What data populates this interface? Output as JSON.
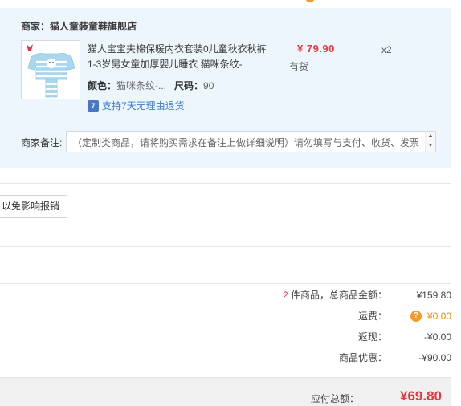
{
  "shop": {
    "label": "商家：",
    "name": "猫人童装童鞋旗舰店"
  },
  "product": {
    "title": "猫人宝宝夹棉保暖内衣套装0儿童秋衣秋裤1-3岁男女童加厚婴儿睡衣 猫咪条纹-",
    "price": "¥ 79.90",
    "stock": "有货",
    "quantity": "x2",
    "color_label": "颜色：",
    "color_value": "猫咪条纹-...",
    "size_label": "尺码：",
    "size_value": "90",
    "return_icon_text": "7",
    "return_policy": "支持7天无理由退货"
  },
  "remark": {
    "label": "商家备注:",
    "placeholder": "（定制类商品，请将购买需求在备注上做详细说明）请勿填写与支付、收货、发票",
    "scroll_up": "▲",
    "scroll_down": "▼"
  },
  "partial_button": {
    "label": "以免影响报销"
  },
  "summary": {
    "count": "2",
    "count_suffix": " 件商品，总商品金额：",
    "goods_amount": "¥159.80",
    "freight_label": "运费：",
    "freight_icon": "?",
    "freight_value": "¥0.00",
    "cashback_label": "返现：",
    "cashback_value": "-¥0.00",
    "discount_label": "商品优惠：",
    "discount_value": "-¥90.00"
  },
  "total": {
    "label": "应付总额：",
    "amount": "¥69.80"
  },
  "colors": {
    "price_red": "#e4393c",
    "freight_orange": "#f18a00",
    "panel_bg": "#eef6fd",
    "link_blue": "#3a7cd5"
  },
  "icons": {
    "product_thumbnail": "pajama-set-image",
    "return": "seven-day-return-icon",
    "freight_help": "question-circle-icon"
  }
}
